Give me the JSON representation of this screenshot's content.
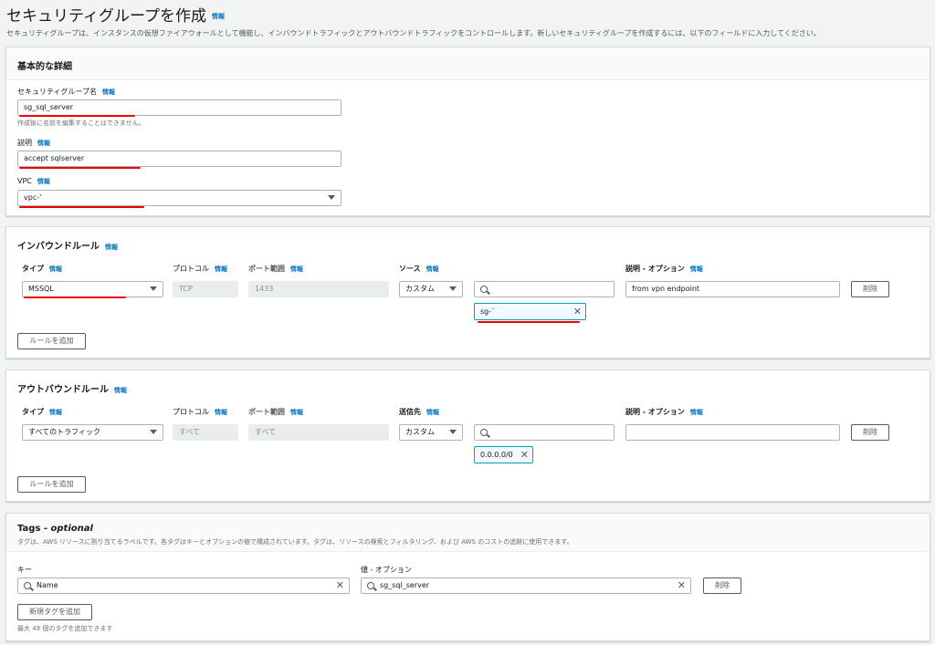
{
  "page": {
    "title": "セキュリティグループを作成",
    "info": "情報",
    "description": "セキュリティグループは、インスタンスの仮想ファイアウォールとして機能し、インバウンドトラフィックとアウトバウンドトラフィックをコントロールします。新しいセキュリティグループを作成するには、以下のフィールドに入力してください。"
  },
  "basic": {
    "title": "基本的な詳細",
    "name_label": "セキュリティグループ名",
    "name_value": "sg_sql_server",
    "name_hint": "作成後に名前を編集することはできません。",
    "desc_label": "説明",
    "desc_value": "accept sqlserver",
    "vpc_label": "VPC",
    "vpc_value": "vpc-'"
  },
  "inbound": {
    "title": "インバウンドルール",
    "col_type": "タイプ",
    "col_protocol": "プロトコル",
    "col_port": "ポート範囲",
    "col_source": "ソース",
    "col_desc": "説明 - オプション",
    "type_value": "MSSQL",
    "protocol_value": "TCP",
    "port_value": "1433",
    "source_value": "カスタム",
    "search_value": "",
    "token": "sg-`",
    "desc_value": "from vpn endpoint",
    "delete_button": "削除",
    "add_button": "ルールを追加"
  },
  "outbound": {
    "title": "アウトバウンドルール",
    "col_type": "タイプ",
    "col_protocol": "プロトコル",
    "col_port": "ポート範囲",
    "col_dest": "送信先",
    "col_desc": "説明 - オプション",
    "type_value": "すべてのトラフィック",
    "protocol_value": "すべて",
    "port_value": "すべて",
    "dest_value": "カスタム",
    "search_value": "",
    "token": "0.0.0.0/0",
    "desc_value": "",
    "delete_button": "削除",
    "add_button": "ルールを追加"
  },
  "tags": {
    "title_prefix": "Tags - ",
    "title_optional": "optional",
    "description": "タグは、AWS リソースに割り当てるラベルです。各タグはキーとオプションの値で構成されています。タグは、リソースの検索とフィルタリング、および AWS のコストの追跡に使用できます。",
    "key_label": "キー",
    "value_label": "値 - オプション",
    "key_value": "Name",
    "value_value": "sg_sql_server",
    "delete_button": "削除",
    "add_button": "新規タグを追加",
    "limit_hint": "最大 49 個のタグを追加できます"
  },
  "icons": {
    "close": "✕"
  }
}
